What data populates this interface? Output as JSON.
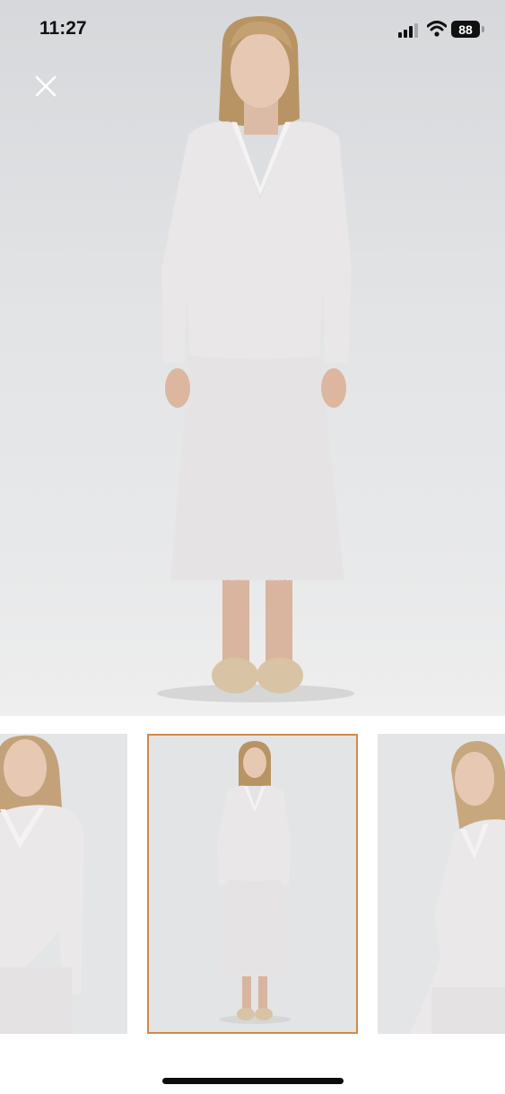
{
  "status_bar": {
    "time": "11:27",
    "battery_level": "88",
    "icons": [
      "cellular-signal-icon",
      "wifi-icon",
      "battery-icon"
    ]
  },
  "viewer": {
    "close_icon": "close-icon",
    "selected_thumbnail_index": 1,
    "thumbnail_count": 3,
    "accent_color": "#d08a4c"
  },
  "colors": {
    "garment": "#e9e6e7",
    "background": "#e2e4e6",
    "hair": "#b89464",
    "shoes": "#d8c3a5"
  }
}
